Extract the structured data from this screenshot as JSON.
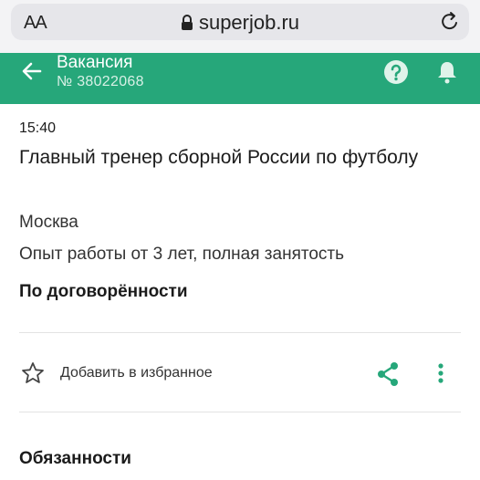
{
  "browser": {
    "text_size_label": "AA",
    "domain": "superjob.ru"
  },
  "header": {
    "title": "Вакансия",
    "subtitle": "№ 38022068"
  },
  "vacancy": {
    "time": "15:40",
    "title": "Главный тренер сборной России по футболу",
    "city": "Москва",
    "experience": "Опыт работы от 3 лет, полная занятость",
    "salary": "По договорённости"
  },
  "actions": {
    "favorite_label": "Добавить в избранное"
  },
  "sections": {
    "duties_title": "Обязанности"
  },
  "colors": {
    "brand_green": "#26a77a",
    "url_bar_bg": "#e6e6ea"
  },
  "icons": [
    "lock-icon",
    "reload-icon",
    "back-arrow-icon",
    "help-icon",
    "bell-icon",
    "star-icon",
    "share-icon",
    "more-vertical-icon"
  ]
}
